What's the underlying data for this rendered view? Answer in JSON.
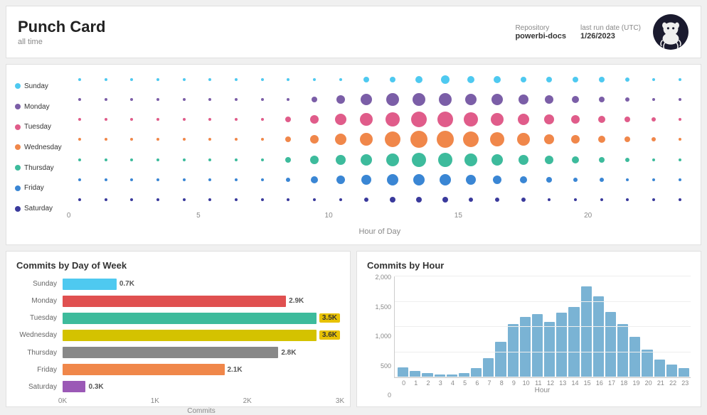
{
  "header": {
    "title": "Punch Card",
    "subtitle": "all time",
    "repo_label": "Repository",
    "repo_value": "powerbi-docs",
    "date_label": "last run date (UTC)",
    "date_value": "1/26/2023"
  },
  "legend": {
    "items": [
      {
        "day": "Sunday",
        "color": "#4ec9f0"
      },
      {
        "day": "Monday",
        "color": "#7b5ea7"
      },
      {
        "day": "Tuesday",
        "color": "#e05c8a"
      },
      {
        "day": "Wednesday",
        "color": "#f0874a"
      },
      {
        "day": "Thursday",
        "color": "#3dbb9c"
      },
      {
        "day": "Friday",
        "color": "#3a86d4"
      },
      {
        "day": "Saturday",
        "color": "#3a3a9c"
      }
    ]
  },
  "x_axis": {
    "labels": [
      "0",
      "5",
      "10",
      "15",
      "20"
    ],
    "positions": [
      0,
      20.8,
      41.7,
      62.5,
      83.3
    ],
    "title": "Hour of Day"
  },
  "commits_by_day": {
    "title": "Commits by Day of Week",
    "bars": [
      {
        "label": "Sunday",
        "value": 0.7,
        "max": 3.6,
        "color": "#4ec9f0",
        "display": "0.7K"
      },
      {
        "label": "Monday",
        "value": 2.9,
        "max": 3.6,
        "color": "#e05050",
        "display": "2.9K"
      },
      {
        "label": "Tuesday",
        "value": 3.5,
        "max": 3.6,
        "color": "#3dbb9c",
        "display": "3.5K",
        "highlight": true
      },
      {
        "label": "Wednesday",
        "value": 3.6,
        "max": 3.6,
        "color": "#d4c200",
        "display": "3.6K",
        "highlight": true
      },
      {
        "label": "Thursday",
        "value": 2.8,
        "max": 3.6,
        "color": "#888888",
        "display": "2.8K"
      },
      {
        "label": "Friday",
        "value": 2.1,
        "max": 3.6,
        "color": "#f0874a",
        "display": "2.1K"
      },
      {
        "label": "Saturday",
        "value": 0.3,
        "max": 3.6,
        "color": "#9b59b6",
        "display": "0.3K"
      }
    ],
    "x_labels": [
      "0K",
      "1K",
      "2K",
      "3K"
    ],
    "x_positions": [
      0,
      33.3,
      66.6,
      100
    ],
    "x_title": "Commits"
  },
  "commits_by_hour": {
    "title": "Commits by Hour",
    "y_label": "2,000",
    "y_ticks": [
      0,
      500,
      1000,
      1500,
      2000
    ],
    "max_value": 2000,
    "bars": [
      {
        "hour": "0",
        "value": 200
      },
      {
        "hour": "1",
        "value": 120
      },
      {
        "hour": "2",
        "value": 80
      },
      {
        "hour": "3",
        "value": 60
      },
      {
        "hour": "4",
        "value": 50
      },
      {
        "hour": "5",
        "value": 80
      },
      {
        "hour": "6",
        "value": 180
      },
      {
        "hour": "7",
        "value": 380
      },
      {
        "hour": "8",
        "value": 700
      },
      {
        "hour": "9",
        "value": 1050
      },
      {
        "hour": "10",
        "value": 1200
      },
      {
        "hour": "11",
        "value": 1250
      },
      {
        "hour": "12",
        "value": 1100
      },
      {
        "hour": "13",
        "value": 1280
      },
      {
        "hour": "14",
        "value": 1400
      },
      {
        "hour": "15",
        "value": 1800
      },
      {
        "hour": "16",
        "value": 1600
      },
      {
        "hour": "17",
        "value": 1300
      },
      {
        "hour": "18",
        "value": 1050
      },
      {
        "hour": "19",
        "value": 800
      },
      {
        "hour": "20",
        "value": 550
      },
      {
        "hour": "21",
        "value": 350
      },
      {
        "hour": "22",
        "value": 250
      },
      {
        "hour": "23",
        "value": 180
      }
    ],
    "x_title": "Hour"
  },
  "punch_grid": {
    "days": [
      "Sunday",
      "Monday",
      "Tuesday",
      "Wednesday",
      "Thursday",
      "Friday",
      "Saturday"
    ],
    "day_colors": [
      "#4ec9f0",
      "#7b5ea7",
      "#e05c8a",
      "#f0874a",
      "#3dbb9c",
      "#3a86d4",
      "#3a3a9c"
    ],
    "hours": 24,
    "sizes": [
      [
        4,
        4,
        4,
        4,
        4,
        4,
        4,
        4,
        4,
        4,
        4,
        8,
        8,
        10,
        12,
        10,
        10,
        8,
        8,
        8,
        8,
        6,
        4,
        4
      ],
      [
        4,
        4,
        4,
        4,
        4,
        4,
        4,
        4,
        4,
        8,
        12,
        16,
        18,
        18,
        18,
        16,
        16,
        14,
        12,
        10,
        8,
        6,
        4,
        4
      ],
      [
        4,
        4,
        4,
        4,
        4,
        4,
        4,
        4,
        8,
        12,
        16,
        18,
        20,
        22,
        22,
        20,
        18,
        16,
        14,
        12,
        10,
        8,
        6,
        4
      ],
      [
        4,
        4,
        4,
        4,
        4,
        4,
        4,
        4,
        8,
        12,
        16,
        18,
        22,
        24,
        24,
        22,
        20,
        18,
        14,
        12,
        10,
        8,
        6,
        4
      ],
      [
        4,
        4,
        4,
        4,
        4,
        4,
        4,
        4,
        8,
        12,
        14,
        16,
        18,
        20,
        20,
        18,
        16,
        14,
        12,
        10,
        8,
        6,
        4,
        4
      ],
      [
        4,
        4,
        4,
        4,
        4,
        4,
        4,
        4,
        6,
        10,
        12,
        14,
        16,
        16,
        16,
        14,
        12,
        10,
        8,
        6,
        6,
        4,
        4,
        4
      ],
      [
        4,
        4,
        4,
        4,
        4,
        4,
        4,
        4,
        4,
        4,
        4,
        6,
        8,
        8,
        8,
        6,
        6,
        6,
        4,
        4,
        4,
        4,
        4,
        4
      ]
    ]
  }
}
